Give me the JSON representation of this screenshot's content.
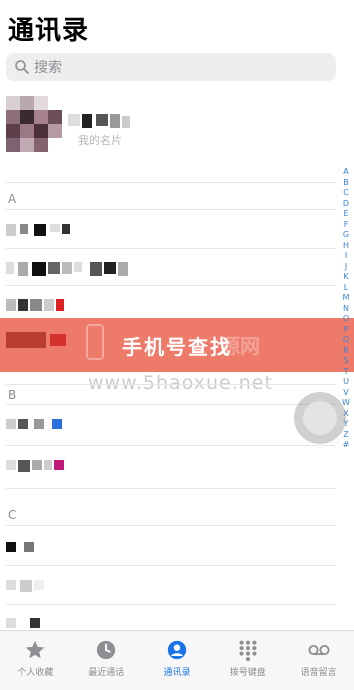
{
  "header": {
    "title": "通讯录"
  },
  "search": {
    "placeholder": "搜索",
    "icon": "search-icon"
  },
  "my_card": {
    "subtitle": "我的名片"
  },
  "sections": [
    {
      "letter": "A"
    },
    {
      "letter": "B"
    },
    {
      "letter": "C"
    }
  ],
  "index_letters": [
    "A",
    "B",
    "C",
    "D",
    "E",
    "F",
    "G",
    "H",
    "I",
    "J",
    "K",
    "L",
    "M",
    "N",
    "O",
    "P",
    "Q",
    "R",
    "S",
    "T",
    "U",
    "V",
    "W",
    "X",
    "Y",
    "Z",
    "#"
  ],
  "banner": {
    "text": "手机号查找",
    "watermark": "源网"
  },
  "watermark_url": "www.5haoxue.net",
  "tabbar": {
    "tabs": [
      {
        "label": "个人收藏",
        "icon": "star-icon",
        "active": false
      },
      {
        "label": "最近通话",
        "icon": "clock-icon",
        "active": false
      },
      {
        "label": "通讯录",
        "icon": "contacts-icon",
        "active": true
      },
      {
        "label": "拨号键盘",
        "icon": "keypad-icon",
        "active": false
      },
      {
        "label": "语音留言",
        "icon": "voicemail-icon",
        "active": false
      }
    ]
  },
  "colors": {
    "accent": "#1a73e8",
    "banner": "#ec6854",
    "index": "#3b82d6"
  }
}
